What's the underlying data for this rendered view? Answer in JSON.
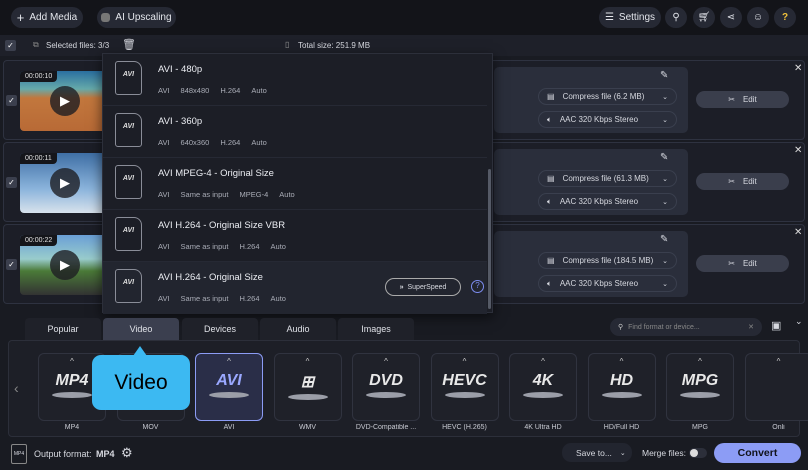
{
  "toolbar": {
    "add_media": "Add Media",
    "ai_upscaling": "AI Upscaling",
    "settings": "Settings"
  },
  "selection": {
    "selected": "Selected files: 3/3",
    "total": "Total size: 251.9 MB"
  },
  "files": [
    {
      "duration": "00:00:10",
      "compress": "Compress file (6.2 MB)",
      "audio": "AAC 320 Kbps Stereo",
      "edit": "Edit"
    },
    {
      "duration": "00:00:11",
      "compress": "Compress file (61.3 MB)",
      "audio": "AAC 320 Kbps Stereo",
      "edit": "Edit"
    },
    {
      "duration": "00:00:22",
      "compress": "Compress file (184.5 MB)",
      "audio": "AAC 320 Kbps Stereo",
      "edit": "Edit"
    }
  ],
  "presets": [
    {
      "title": "AVI - 480p",
      "specs": [
        "AVI",
        "848x480",
        "H.264",
        "Auto"
      ]
    },
    {
      "title": "AVI - 360p",
      "specs": [
        "AVI",
        "640x360",
        "H.264",
        "Auto"
      ]
    },
    {
      "title": "AVI MPEG-4 - Original Size",
      "specs": [
        "AVI",
        "Same as input",
        "MPEG-4",
        "Auto"
      ]
    },
    {
      "title": "AVI H.264 - Original Size VBR",
      "specs": [
        "AVI",
        "Same as input",
        "H.264",
        "Auto"
      ]
    },
    {
      "title": "AVI H.264 - Original Size",
      "specs": [
        "AVI",
        "Same as input",
        "H.264",
        "Auto"
      ],
      "badge": "SuperSpeed"
    }
  ],
  "preset_icon_label": "AVI",
  "tabs": [
    "Popular",
    "Video",
    "Devices",
    "Audio",
    "Images"
  ],
  "search_placeholder": "Find format or device...",
  "formats": [
    {
      "logo": "MP4",
      "label": "MP4"
    },
    {
      "logo": "MOV",
      "label": "MOV"
    },
    {
      "logo": "AVI",
      "label": "AVI"
    },
    {
      "logo": "⊞",
      "label": "WMV"
    },
    {
      "logo": "DVD",
      "label": "DVD-Compatible ..."
    },
    {
      "logo": "HEVC",
      "label": "HEVC (H.265)"
    },
    {
      "logo": "4K",
      "label": "4K Ultra HD"
    },
    {
      "logo": "HD",
      "label": "HD/Full HD"
    },
    {
      "logo": "MPG",
      "label": "MPG"
    },
    {
      "logo": "",
      "label": "Onli"
    }
  ],
  "tooltip": "Video",
  "footer": {
    "output_label": "Output format:",
    "output_value": "MP4",
    "save_to": "Save to...",
    "merge": "Merge files:",
    "convert": "Convert"
  },
  "colors": {
    "accent": "#8c9cf5",
    "tooltip": "#3cb9f2"
  }
}
